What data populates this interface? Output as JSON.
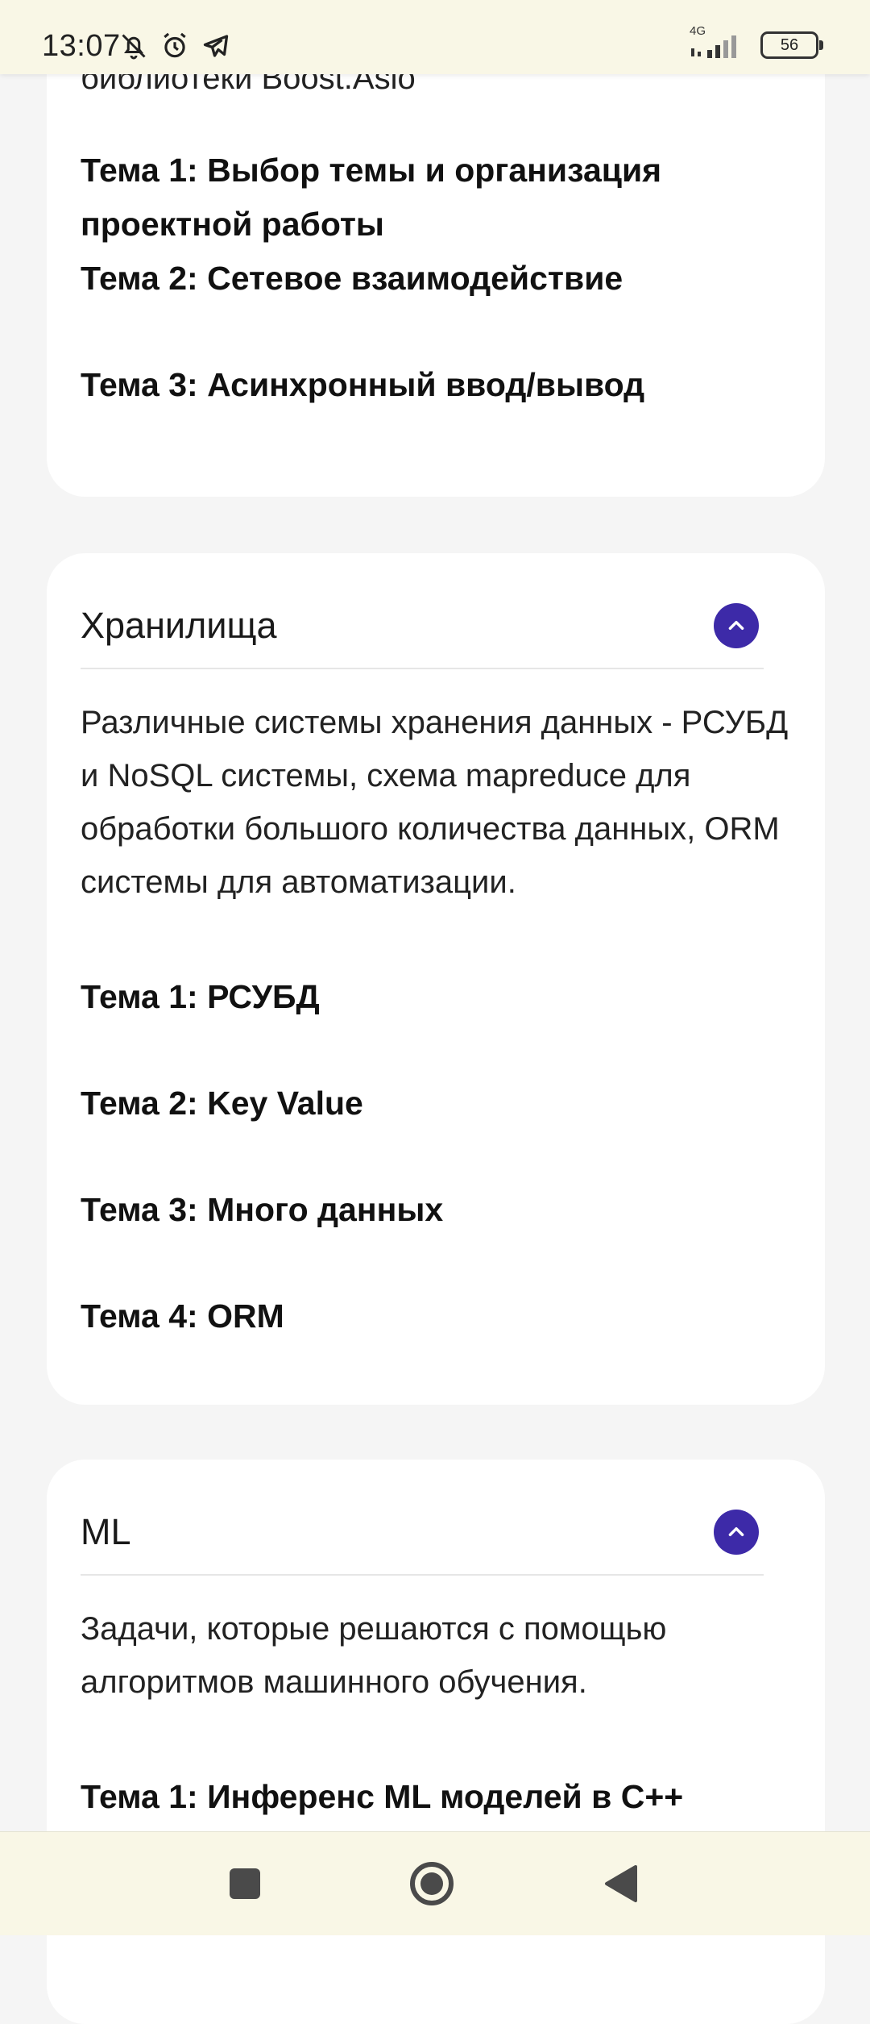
{
  "status_bar": {
    "time": "13:07",
    "network": "4G",
    "battery": "56",
    "icons": [
      "bell-off-icon",
      "alarm-icon",
      "telegram-icon",
      "signal-icon",
      "battery-icon"
    ]
  },
  "course_card_1": {
    "partial_text": "библиотеки Boost.Asio",
    "topics": [
      "Тема 1: Выбор темы и организация проектной работы",
      "Тема 2: Сетевое взаимодействие",
      "Тема 3: Асинхронный ввод/вывод"
    ]
  },
  "course_card_2": {
    "title": "Хранилища",
    "description": "Различные системы хранения данных - РСУБД и NoSQL системы, схема mapreduce для обработки большого количества данных, ORM системы для автоматизации.",
    "topics": [
      "Тема 1: РСУБД",
      "Тема 2: Key Value",
      "Тема 3: Много данных",
      "Тема 4: ORM"
    ]
  },
  "course_card_3": {
    "title": "ML",
    "description": "Задачи, которые решаются с помощью алгоритмов машинного обучения.",
    "topics": [
      "Тема 1: Инференс ML моделей в С++"
    ]
  },
  "colors": {
    "accent": "#3d2aa8",
    "bars_bg": "#f9f7e6",
    "page_bg": "#f5f5f5",
    "card_bg": "#ffffff"
  },
  "nav_bar": {
    "icons": [
      "recents-square-icon",
      "home-circle-icon",
      "back-triangle-icon"
    ]
  }
}
